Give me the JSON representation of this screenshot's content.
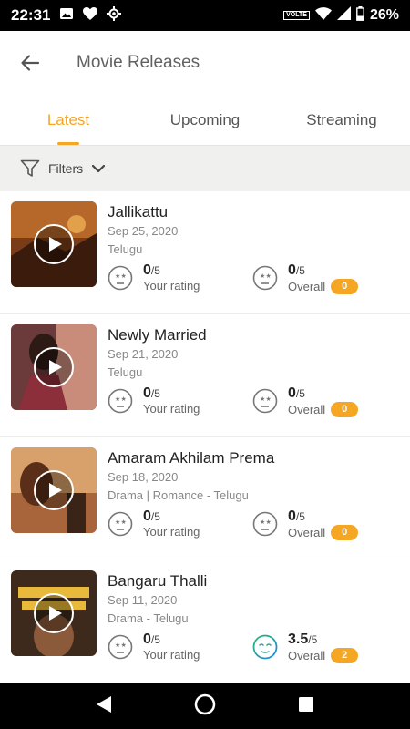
{
  "status_bar": {
    "time": "22:31",
    "volte": "VOLTE",
    "battery": "26%",
    "icons": [
      "image-icon",
      "heart-icon",
      "location-icon",
      "volte-icon",
      "wifi-icon",
      "signal-icon",
      "battery-icon"
    ]
  },
  "header": {
    "title": "Movie Releases",
    "back_icon": "back-arrow-icon"
  },
  "tabs": [
    {
      "label": "Latest",
      "active": true
    },
    {
      "label": "Upcoming",
      "active": false
    },
    {
      "label": "Streaming",
      "active": false
    }
  ],
  "filters": {
    "label": "Filters",
    "icons": [
      "filter-icon",
      "chevron-down-icon"
    ]
  },
  "movies": [
    {
      "title": "Jallikattu",
      "date": "Sep 25, 2020",
      "genre": "Telugu",
      "your_rating": {
        "value": "0",
        "out_of": "/5",
        "label": "Your rating"
      },
      "overall": {
        "value": "0",
        "out_of": "/5",
        "label": "Overall",
        "count": "0"
      }
    },
    {
      "title": "Newly Married",
      "date": "Sep 21, 2020",
      "genre": "Telugu",
      "your_rating": {
        "value": "0",
        "out_of": "/5",
        "label": "Your rating"
      },
      "overall": {
        "value": "0",
        "out_of": "/5",
        "label": "Overall",
        "count": "0"
      }
    },
    {
      "title": "Amaram Akhilam Prema",
      "date": "Sep 18, 2020",
      "genre": "Drama | Romance - Telugu",
      "your_rating": {
        "value": "0",
        "out_of": "/5",
        "label": "Your rating"
      },
      "overall": {
        "value": "0",
        "out_of": "/5",
        "label": "Overall",
        "count": "0"
      }
    },
    {
      "title": "Bangaru Thalli",
      "date": "Sep 11, 2020",
      "genre": "Drama - Telugu",
      "your_rating": {
        "value": "0",
        "out_of": "/5",
        "label": "Your rating"
      },
      "overall": {
        "value": "3.5",
        "out_of": "/5",
        "label": "Overall",
        "count": "2"
      }
    }
  ],
  "colors": {
    "accent": "#f5a623",
    "rated_icon": "#1fa37a",
    "text_dark": "#222222",
    "text_muted": "#888888"
  },
  "nav_bar": {
    "icons": [
      "back-triangle-icon",
      "home-circle-icon",
      "recents-square-icon"
    ]
  }
}
